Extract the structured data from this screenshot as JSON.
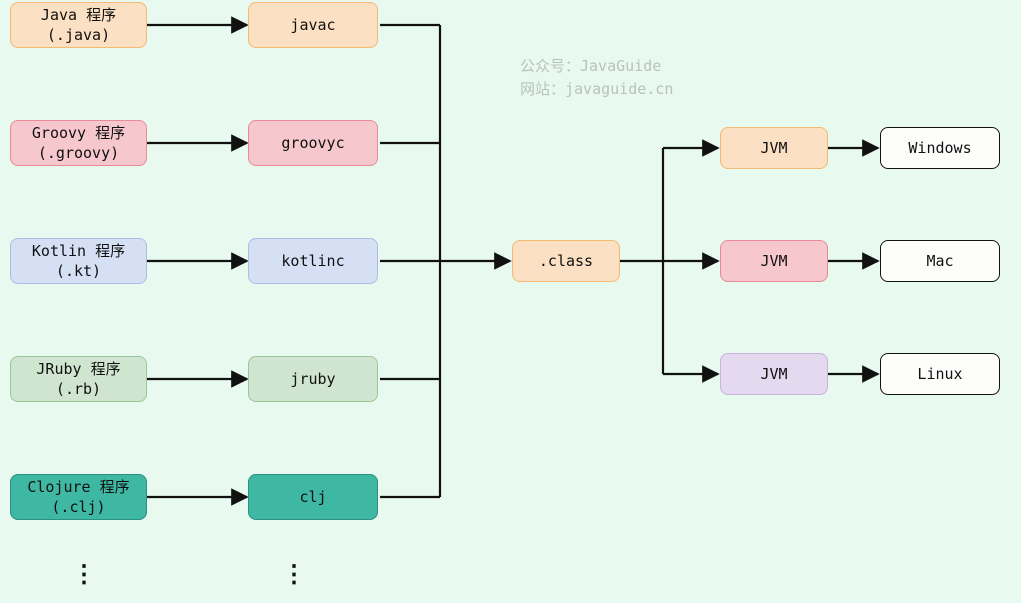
{
  "watermark": {
    "line1": "公众号：JavaGuide",
    "line2": "网站：javaguide.cn"
  },
  "sources": {
    "java": {
      "label": "Java 程序\n(.java)",
      "compiler": "javac"
    },
    "groovy": {
      "label": "Groovy 程序\n(.groovy)",
      "compiler": "groovyc"
    },
    "kotlin": {
      "label": "Kotlin 程序\n(.kt)",
      "compiler": "kotlinc"
    },
    "jruby": {
      "label": "JRuby 程序\n(.rb)",
      "compiler": "jruby"
    },
    "clojure": {
      "label": "Clojure 程序\n(.clj)",
      "compiler": "clj"
    }
  },
  "class_file": ".class",
  "jvms": {
    "windows": {
      "label": "JVM",
      "os": "Windows"
    },
    "mac": {
      "label": "JVM",
      "os": "Mac"
    },
    "linux": {
      "label": "JVM",
      "os": "Linux"
    }
  },
  "ellipsis": "⋮"
}
